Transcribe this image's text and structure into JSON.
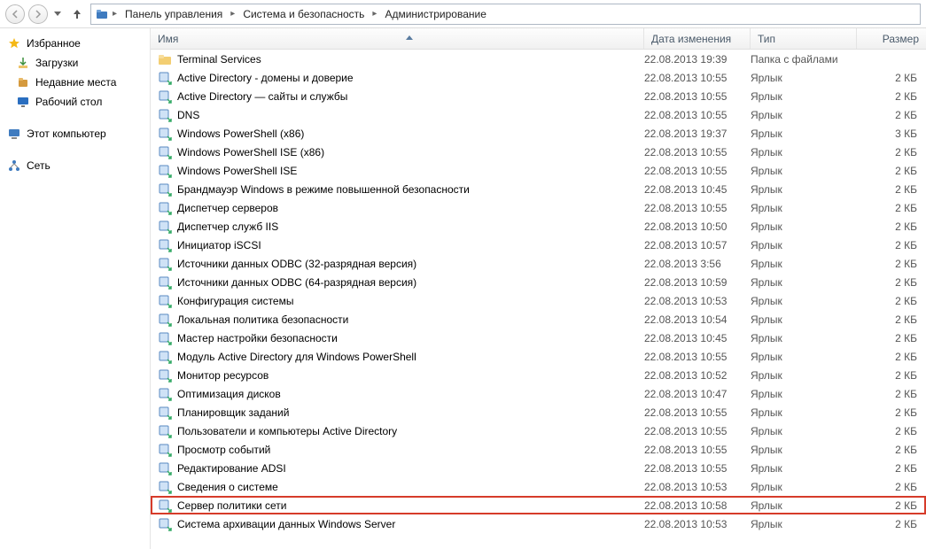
{
  "breadcrumbs": [
    "Панель управления",
    "Система и безопасность",
    "Администрирование"
  ],
  "sidebar": {
    "favorites": {
      "title": "Избранное",
      "items": [
        "Загрузки",
        "Недавние места",
        "Рабочий стол"
      ]
    },
    "computer": "Этот компьютер",
    "network": "Сеть"
  },
  "columns": {
    "name": "Имя",
    "date": "Дата изменения",
    "type": "Тип",
    "size": "Размер"
  },
  "types": {
    "folder": "Папка с файлами",
    "shortcut": "Ярлык"
  },
  "rows": [
    {
      "icon": "folder",
      "name": "Terminal Services",
      "date": "22.08.2013 19:39",
      "type": "folder",
      "size": ""
    },
    {
      "icon": "shortcut",
      "name": "Active Directory - домены и доверие",
      "date": "22.08.2013 10:55",
      "type": "shortcut",
      "size": "2 КБ"
    },
    {
      "icon": "shortcut",
      "name": "Active Directory — сайты и службы",
      "date": "22.08.2013 10:55",
      "type": "shortcut",
      "size": "2 КБ"
    },
    {
      "icon": "shortcut",
      "name": "DNS",
      "date": "22.08.2013 10:55",
      "type": "shortcut",
      "size": "2 КБ"
    },
    {
      "icon": "shortcut",
      "name": "Windows PowerShell (x86)",
      "date": "22.08.2013 19:37",
      "type": "shortcut",
      "size": "3 КБ"
    },
    {
      "icon": "shortcut",
      "name": "Windows PowerShell ISE (x86)",
      "date": "22.08.2013 10:55",
      "type": "shortcut",
      "size": "2 КБ"
    },
    {
      "icon": "shortcut",
      "name": "Windows PowerShell ISE",
      "date": "22.08.2013 10:55",
      "type": "shortcut",
      "size": "2 КБ"
    },
    {
      "icon": "shortcut",
      "name": "Брандмауэр Windows в режиме повышенной безопасности",
      "date": "22.08.2013 10:45",
      "type": "shortcut",
      "size": "2 КБ"
    },
    {
      "icon": "shortcut",
      "name": "Диспетчер серверов",
      "date": "22.08.2013 10:55",
      "type": "shortcut",
      "size": "2 КБ"
    },
    {
      "icon": "shortcut",
      "name": "Диспетчер служб IIS",
      "date": "22.08.2013 10:50",
      "type": "shortcut",
      "size": "2 КБ"
    },
    {
      "icon": "shortcut",
      "name": "Инициатор iSCSI",
      "date": "22.08.2013 10:57",
      "type": "shortcut",
      "size": "2 КБ"
    },
    {
      "icon": "shortcut",
      "name": "Источники данных ODBC (32-разрядная версия)",
      "date": "22.08.2013 3:56",
      "type": "shortcut",
      "size": "2 КБ"
    },
    {
      "icon": "shortcut",
      "name": "Источники данных ODBC (64-разрядная версия)",
      "date": "22.08.2013 10:59",
      "type": "shortcut",
      "size": "2 КБ"
    },
    {
      "icon": "shortcut",
      "name": "Конфигурация системы",
      "date": "22.08.2013 10:53",
      "type": "shortcut",
      "size": "2 КБ"
    },
    {
      "icon": "shortcut",
      "name": "Локальная политика безопасности",
      "date": "22.08.2013 10:54",
      "type": "shortcut",
      "size": "2 КБ"
    },
    {
      "icon": "shortcut",
      "name": "Мастер настройки безопасности",
      "date": "22.08.2013 10:45",
      "type": "shortcut",
      "size": "2 КБ"
    },
    {
      "icon": "shortcut",
      "name": "Модуль Active Directory для Windows PowerShell",
      "date": "22.08.2013 10:55",
      "type": "shortcut",
      "size": "2 КБ"
    },
    {
      "icon": "shortcut",
      "name": "Монитор ресурсов",
      "date": "22.08.2013 10:52",
      "type": "shortcut",
      "size": "2 КБ"
    },
    {
      "icon": "shortcut",
      "name": "Оптимизация дисков",
      "date": "22.08.2013 10:47",
      "type": "shortcut",
      "size": "2 КБ"
    },
    {
      "icon": "shortcut",
      "name": "Планировщик заданий",
      "date": "22.08.2013 10:55",
      "type": "shortcut",
      "size": "2 КБ"
    },
    {
      "icon": "shortcut",
      "name": "Пользователи и компьютеры Active Directory",
      "date": "22.08.2013 10:55",
      "type": "shortcut",
      "size": "2 КБ"
    },
    {
      "icon": "shortcut",
      "name": "Просмотр событий",
      "date": "22.08.2013 10:55",
      "type": "shortcut",
      "size": "2 КБ"
    },
    {
      "icon": "shortcut",
      "name": "Редактирование ADSI",
      "date": "22.08.2013 10:55",
      "type": "shortcut",
      "size": "2 КБ"
    },
    {
      "icon": "shortcut",
      "name": "Сведения о системе",
      "date": "22.08.2013 10:53",
      "type": "shortcut",
      "size": "2 КБ"
    },
    {
      "icon": "shortcut",
      "name": "Сервер политики сети",
      "date": "22.08.2013 10:58",
      "type": "shortcut",
      "size": "2 КБ",
      "highlight": true
    },
    {
      "icon": "shortcut",
      "name": "Система архивации данных Windows Server",
      "date": "22.08.2013 10:53",
      "type": "shortcut",
      "size": "2 КБ"
    }
  ]
}
